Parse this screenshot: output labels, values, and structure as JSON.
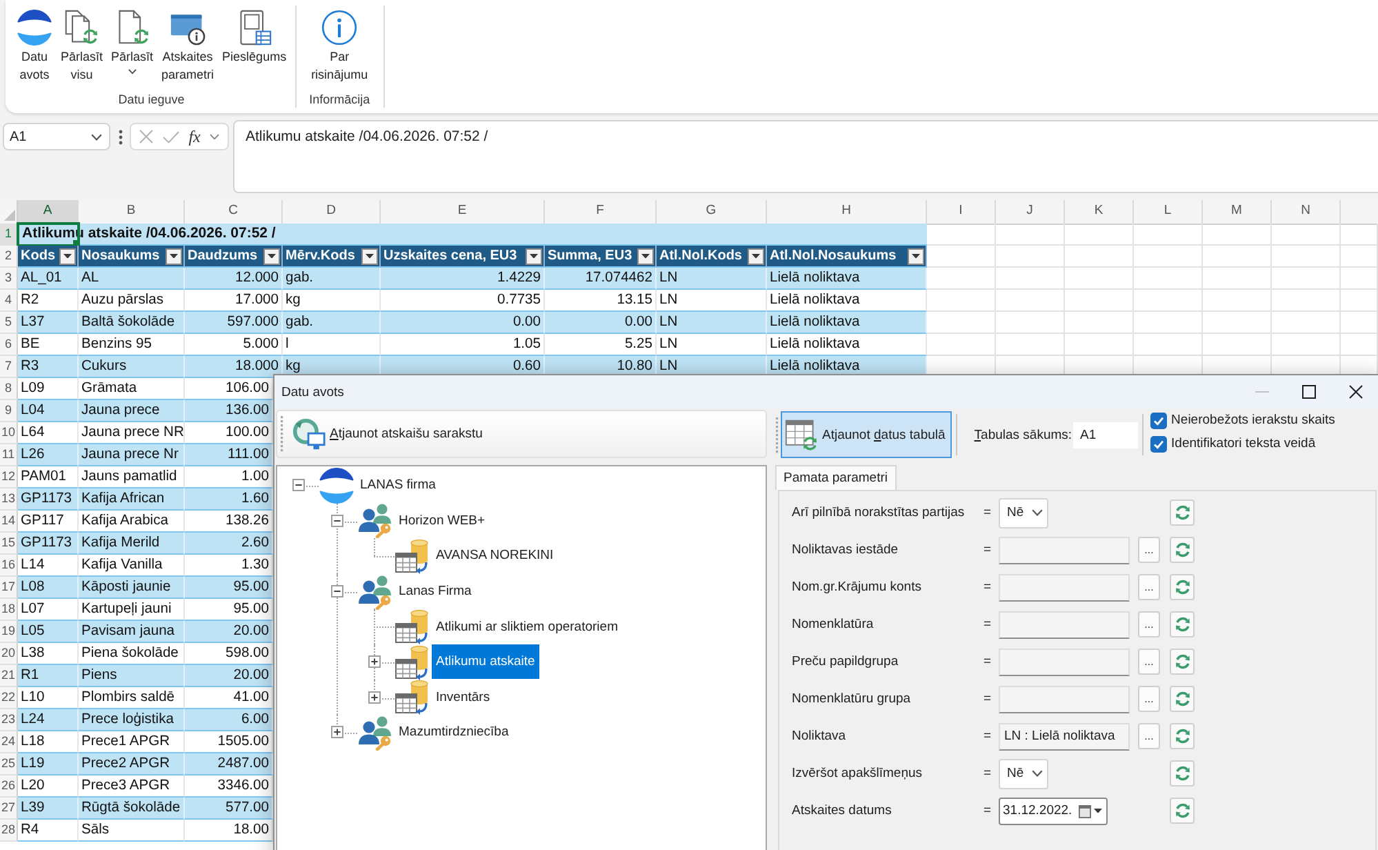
{
  "ribbon": {
    "groups": [
      {
        "label": "Datu ieguve",
        "buttons": [
          {
            "kind": "logo",
            "label": "Datu\navots"
          },
          {
            "kind": "reload_all",
            "label": "Pārlasīt\nvisu"
          },
          {
            "kind": "reload",
            "label": "Pārlasīt",
            "dropdown": true
          },
          {
            "kind": "report_params",
            "label": "Atskaites\nparametri"
          },
          {
            "kind": "connection",
            "label": "Pieslēgums"
          }
        ]
      },
      {
        "label": "Informācija",
        "buttons": [
          {
            "kind": "info",
            "label": "Par\nrisinājumu"
          }
        ]
      }
    ]
  },
  "formula_bar": {
    "name_box": "A1",
    "function_label": "fx",
    "content": "Atlikumu atskaite /04.06.2026. 07:52 /"
  },
  "sheet": {
    "columns": [
      {
        "label": "A",
        "selected": true
      },
      {
        "label": "B",
        "selected": false
      },
      {
        "label": "C",
        "selected": false
      },
      {
        "label": "D",
        "selected": false
      },
      {
        "label": "E",
        "selected": false
      },
      {
        "label": "F",
        "selected": false
      },
      {
        "label": "G",
        "selected": false
      },
      {
        "label": "H",
        "selected": false
      },
      {
        "label": "I",
        "selected": false
      },
      {
        "label": "J",
        "selected": false
      },
      {
        "label": "K",
        "selected": false
      },
      {
        "label": "L",
        "selected": false
      },
      {
        "label": "M",
        "selected": false
      },
      {
        "label": "N",
        "selected": false
      }
    ],
    "title_row": {
      "number": "1",
      "text": "Atlikumu atskaite /04.06.2026. 07:52 /",
      "selected": true
    },
    "header_row": {
      "number": "2",
      "headers": [
        "Kods",
        "Nosaukums",
        "Daudzums",
        "Mērv.Kods",
        "Uzskaites cena, EU3",
        "Summa, EU3",
        "Atl.Nol.Kods",
        "Atl.Nol.Nosaukums"
      ]
    },
    "rows": [
      {
        "number": "3",
        "cells": [
          "AL_01",
          "AL",
          "12.000",
          "gab.",
          "1.4229",
          "17.074462",
          "LN",
          "Lielā noliktava"
        ]
      },
      {
        "number": "4",
        "cells": [
          "R2",
          "Auzu pārslas",
          "17.000",
          "kg",
          "0.7735",
          "13.15",
          "LN",
          "Lielā noliktava"
        ]
      },
      {
        "number": "5",
        "cells": [
          "L37",
          "Baltā šokolāde",
          "597.000",
          "gab.",
          "0.00",
          "0.00",
          "LN",
          "Lielā noliktava"
        ]
      },
      {
        "number": "6",
        "cells": [
          "BE",
          "Benzins 95",
          "5.000",
          "l",
          "1.05",
          "5.25",
          "LN",
          "Lielā noliktava"
        ]
      },
      {
        "number": "7",
        "cells": [
          "R3",
          "Cukurs",
          "18.000",
          "kg",
          "0.60",
          "10.80",
          "LN",
          "Lielā noliktava"
        ]
      },
      {
        "number": "8",
        "cells": [
          "L09",
          "Grāmata",
          "106.00"
        ]
      },
      {
        "number": "9",
        "cells": [
          "L04",
          "Jauna prece",
          "136.00"
        ]
      },
      {
        "number": "10",
        "cells": [
          "L64",
          "Jauna prece NR",
          "100.00"
        ]
      },
      {
        "number": "11",
        "cells": [
          "L26",
          "Jauna prece Nr",
          "111.00"
        ]
      },
      {
        "number": "12",
        "cells": [
          "PAM01",
          "Jauns pamatlid",
          "1.00"
        ]
      },
      {
        "number": "13",
        "cells": [
          "GP1173",
          "Kafija African",
          "1.60"
        ]
      },
      {
        "number": "14",
        "cells": [
          "GP117",
          "Kafija Arabica",
          "138.26"
        ]
      },
      {
        "number": "15",
        "cells": [
          "GP1173",
          "Kafija Merild",
          "2.60"
        ]
      },
      {
        "number": "16",
        "cells": [
          "L14",
          "Kafija Vanilla",
          "1.30"
        ]
      },
      {
        "number": "17",
        "cells": [
          "L08",
          "Kāposti jaunie",
          "95.00"
        ]
      },
      {
        "number": "18",
        "cells": [
          "L07",
          "Kartupeļi jauni",
          "95.00"
        ]
      },
      {
        "number": "19",
        "cells": [
          "L05",
          "Pavisam jauna",
          "20.00"
        ]
      },
      {
        "number": "20",
        "cells": [
          "L38",
          "Piena šokolāde",
          "598.00"
        ]
      },
      {
        "number": "21",
        "cells": [
          "R1",
          "Piens",
          "20.00"
        ]
      },
      {
        "number": "22",
        "cells": [
          "L10",
          "Plombirs saldē",
          "41.00"
        ]
      },
      {
        "number": "23",
        "cells": [
          "L24",
          "Prece loģistika",
          "6.00"
        ]
      },
      {
        "number": "24",
        "cells": [
          "L18",
          "Prece1 APGR",
          "1505.00"
        ]
      },
      {
        "number": "25",
        "cells": [
          "L19",
          "Prece2 APGR",
          "2487.00"
        ]
      },
      {
        "number": "26",
        "cells": [
          "L20",
          "Prece3 APGR",
          "3346.00"
        ]
      },
      {
        "number": "27",
        "cells": [
          "L39",
          "Rūgtā šokolāde",
          "577.00"
        ]
      },
      {
        "number": "28",
        "cells": [
          "R4",
          "Sāls",
          "18.00"
        ]
      }
    ]
  },
  "dialog": {
    "title": "Datu avots",
    "window_controls": [
      {
        "kind": "minimize",
        "disabled": true
      },
      {
        "kind": "maximize",
        "disabled": false
      },
      {
        "kind": "close",
        "disabled": false
      }
    ],
    "report_list": {
      "toolbar_button": {
        "label_runs": [
          {
            "text": "A",
            "underline": true
          },
          {
            "text": "tjaunot atskaišu sarakstu",
            "underline": false
          }
        ],
        "pressed": false
      },
      "tree": [
        {
          "label": "LANAS firma",
          "kind": "company",
          "expanded": true,
          "selected": false,
          "children": [
            {
              "label": "Horizon WEB+",
              "kind": "group",
              "expanded": true,
              "selected": false,
              "children": [
                {
                  "label": "AVANSA NOREKINI",
                  "kind": "report",
                  "selected": false
                }
              ]
            },
            {
              "label": "Lanas Firma",
              "kind": "group",
              "expanded": true,
              "selected": false,
              "children": [
                {
                  "label": "Atlikumi ar sliktiem operatoriem",
                  "kind": "report",
                  "selected": false
                },
                {
                  "label": "Atlikumu atskaite",
                  "kind": "report",
                  "expanded": false,
                  "selected": true
                },
                {
                  "label": "Inventārs",
                  "kind": "report",
                  "expanded": false,
                  "selected": false
                }
              ]
            },
            {
              "label": "Mazumtirdzniecība",
              "kind": "group",
              "expanded": false,
              "selected": false
            }
          ]
        }
      ]
    },
    "parameters": {
      "toolbar_button": {
        "label_runs": [
          {
            "text": "Atjaunot ",
            "underline": false
          },
          {
            "text": "d",
            "underline": true
          },
          {
            "text": "atus tabulā",
            "underline": false
          }
        ],
        "pressed": true
      },
      "table_start": {
        "label_runs": [
          {
            "text": "T",
            "underline": true
          },
          {
            "text": "abulas sākums:",
            "underline": false
          }
        ],
        "value": "A1"
      },
      "options": [
        {
          "label": "Neierobežots ierakstu skaits",
          "checked": true
        },
        {
          "label": "Identifikatori teksta veidā",
          "checked": true
        }
      ],
      "tabs": [
        {
          "label": "Pamata parametri",
          "selected": true
        }
      ],
      "fields": [
        {
          "kind": "select",
          "label": "Arī pilnībā norakstītas partijas",
          "operator": "=",
          "value": "Nē"
        },
        {
          "kind": "lookup",
          "label": "Noliktavas iestāde",
          "operator": "=",
          "browse": "..."
        },
        {
          "kind": "lookup",
          "label": "Nom.gr.Krājumu konts",
          "operator": "=",
          "browse": "..."
        },
        {
          "kind": "lookup",
          "label": "Nomenklatūra",
          "operator": "=",
          "browse": "..."
        },
        {
          "kind": "lookup",
          "label": "Preču papildgrupa",
          "operator": "=",
          "browse": "..."
        },
        {
          "kind": "lookup",
          "label": "Nomenklatūru grupa",
          "operator": "=",
          "browse": "..."
        },
        {
          "kind": "lookup",
          "label": "Noliktava",
          "operator": "=",
          "value": "LN : Lielā noliktava",
          "browse": "..."
        },
        {
          "kind": "select",
          "label": "Izvēršot apakšlīmeņus",
          "operator": "=",
          "value": "Nē"
        },
        {
          "kind": "date",
          "label": "Atskaites datums",
          "operator": "=",
          "value": "31.12.2022."
        }
      ]
    }
  }
}
